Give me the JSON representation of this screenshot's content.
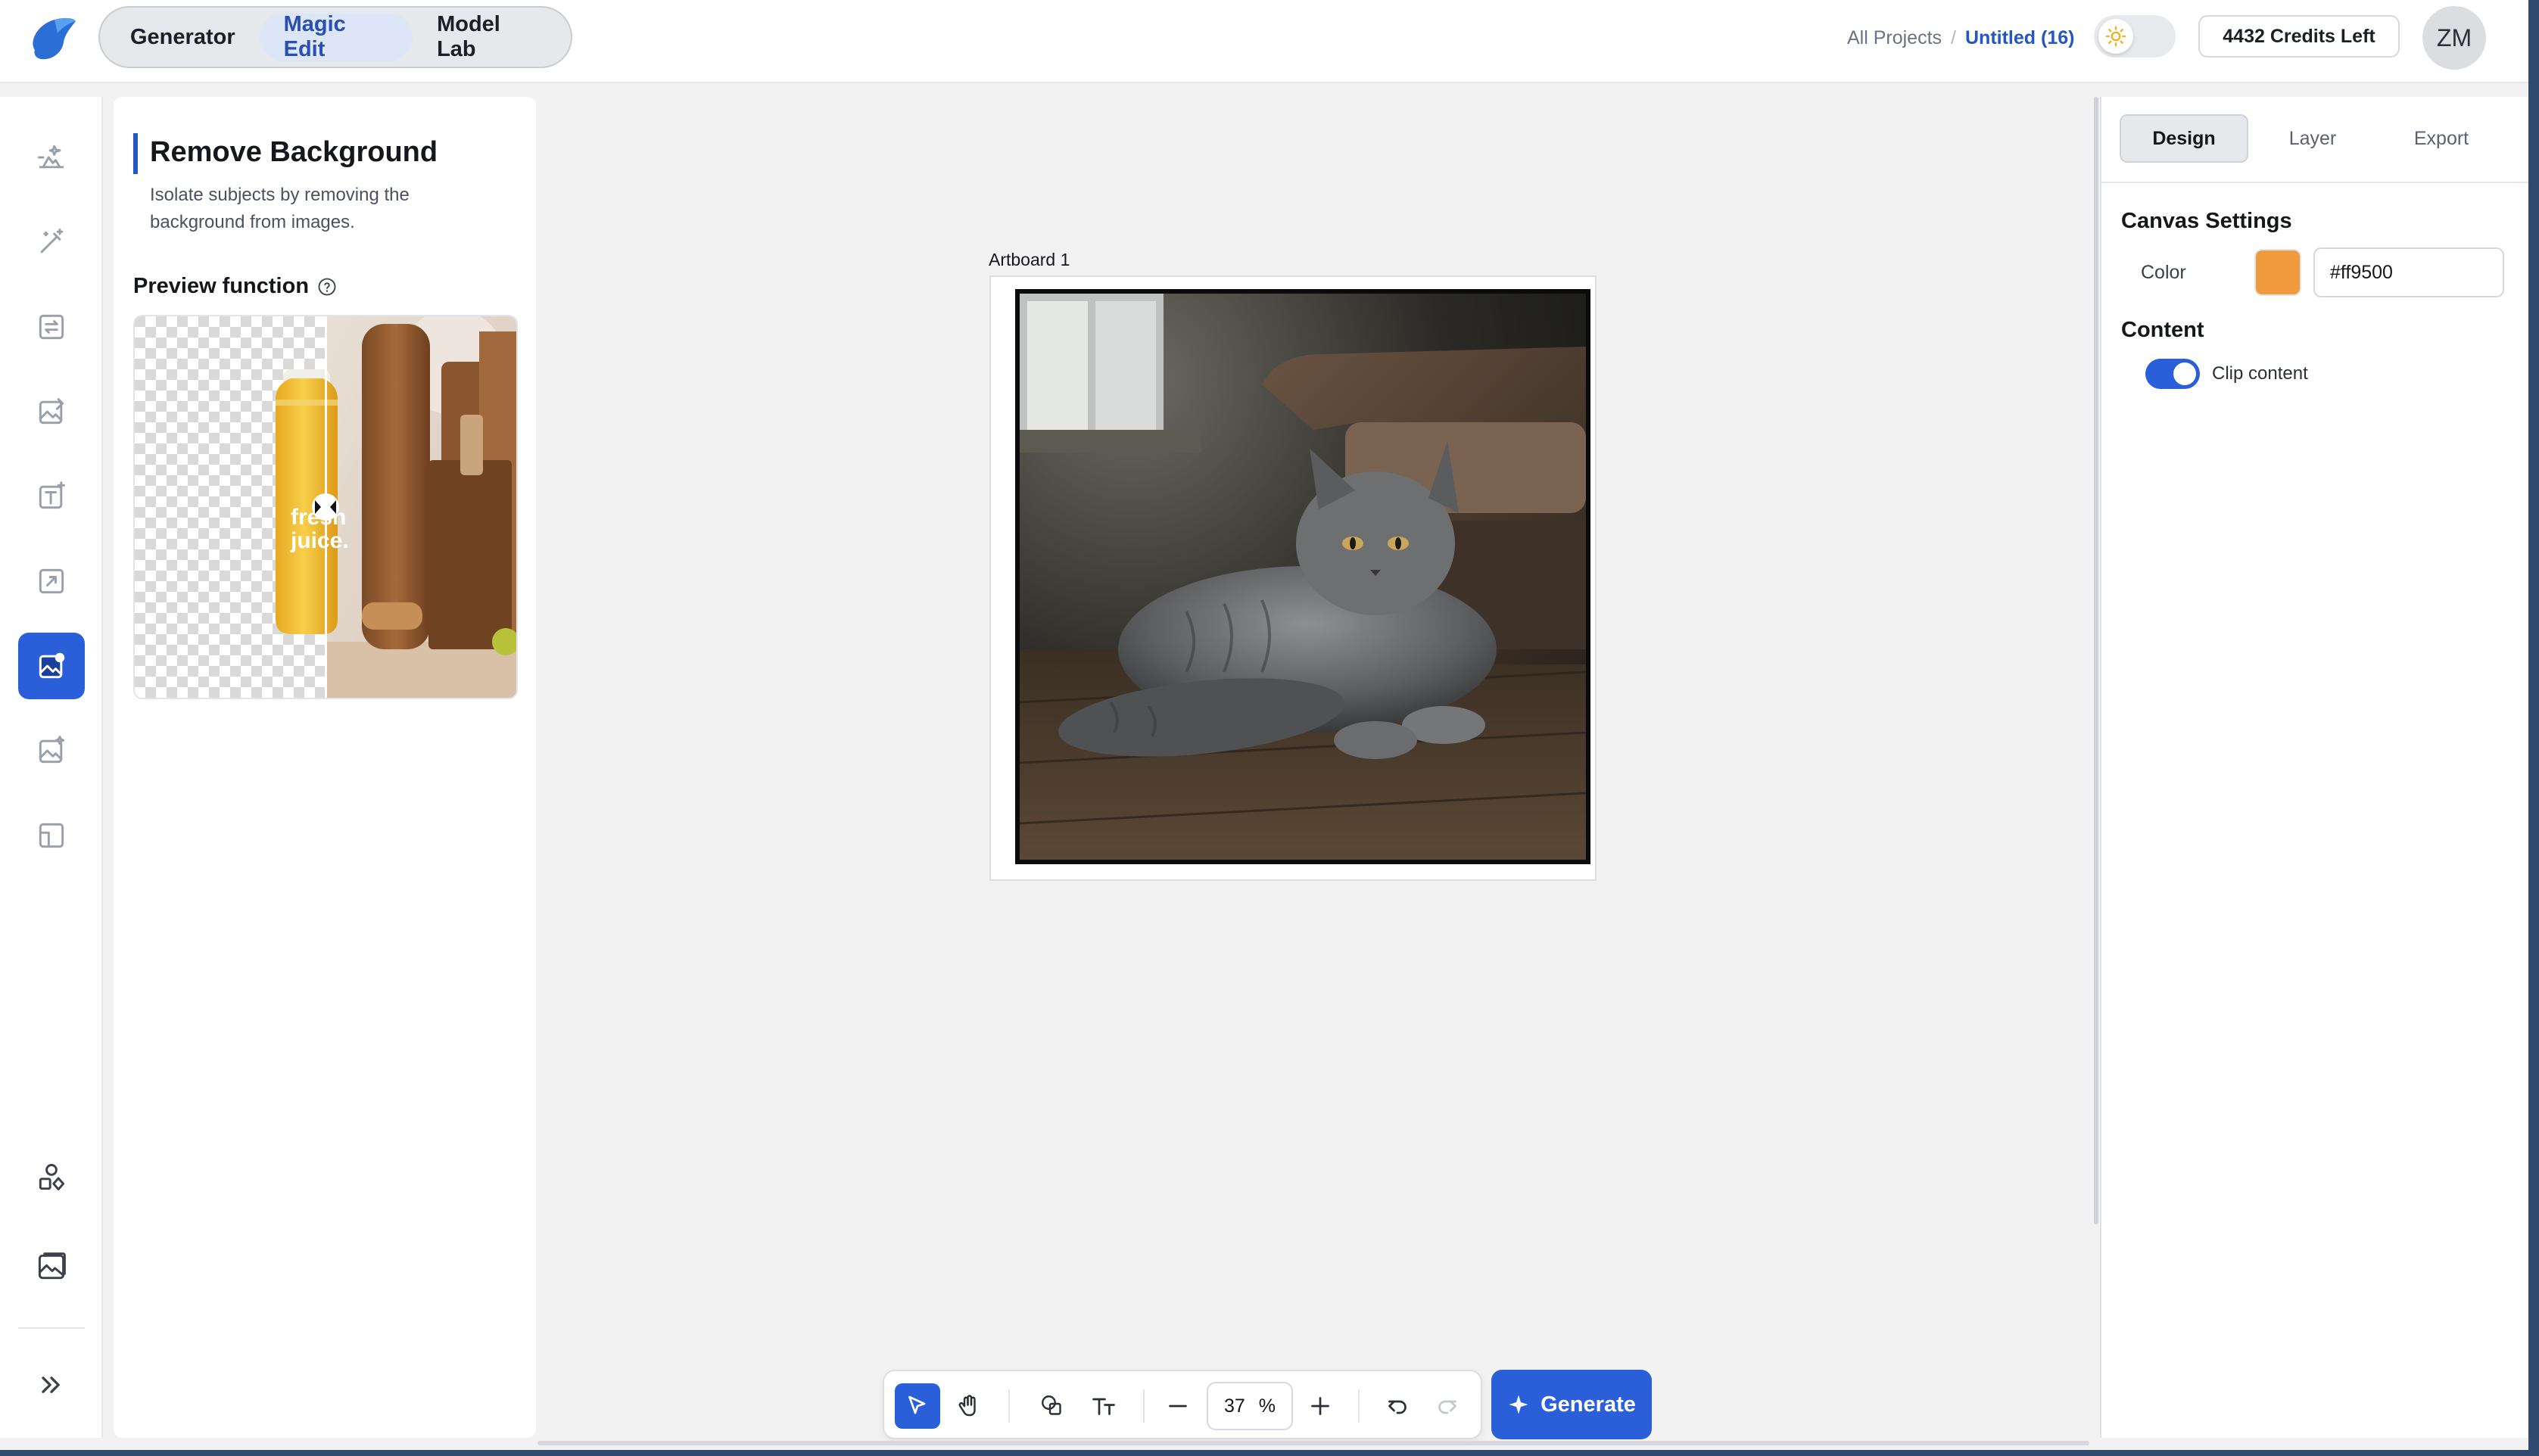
{
  "header": {
    "modes": [
      {
        "label": "Generator",
        "active": false
      },
      {
        "label": "Magic Edit",
        "active": true
      },
      {
        "label": "Model Lab",
        "active": false
      }
    ],
    "breadcrumb": {
      "root": "All Projects",
      "separator": "/",
      "current": "Untitled (16)"
    },
    "credits": "4432 Credits Left",
    "avatar_initials": "ZM"
  },
  "rail": {
    "items": [
      {
        "icon": "text-to-image-icon"
      },
      {
        "icon": "magic-wand-icon"
      },
      {
        "icon": "image-swap-icon"
      },
      {
        "icon": "image-edit-icon"
      },
      {
        "icon": "text-insert-icon"
      },
      {
        "icon": "image-expand-icon"
      },
      {
        "icon": "remove-background-icon",
        "active": true
      },
      {
        "icon": "image-enhance-icon"
      },
      {
        "icon": "resize-icon"
      }
    ],
    "bottom": [
      {
        "icon": "shapes-icon"
      },
      {
        "icon": "gallery-icon"
      },
      {
        "icon": "expand-chevrons-icon"
      }
    ]
  },
  "tool_panel": {
    "title": "Remove Background",
    "description": "Isolate subjects by removing the background from images.",
    "preview_label": "Preview function",
    "preview_bottle_text": [
      "fresh",
      "juice."
    ]
  },
  "canvas": {
    "artboard_label": "Artboard 1"
  },
  "right_panel": {
    "tabs": [
      {
        "label": "Design",
        "active": true
      },
      {
        "label": "Layer",
        "active": false
      },
      {
        "label": "Export",
        "active": false
      }
    ],
    "canvas_settings_title": "Canvas Settings",
    "color_label": "Color",
    "color_value": "#ff9500",
    "swatch_color": "#f09a3e",
    "content_title": "Content",
    "clip_content_label": "Clip content",
    "clip_content_on": true
  },
  "toolbar": {
    "zoom_value": "37",
    "zoom_unit": "%",
    "generate_label": "Generate"
  },
  "colors": {
    "accent": "#2b5fd9",
    "link": "#2456c4"
  }
}
